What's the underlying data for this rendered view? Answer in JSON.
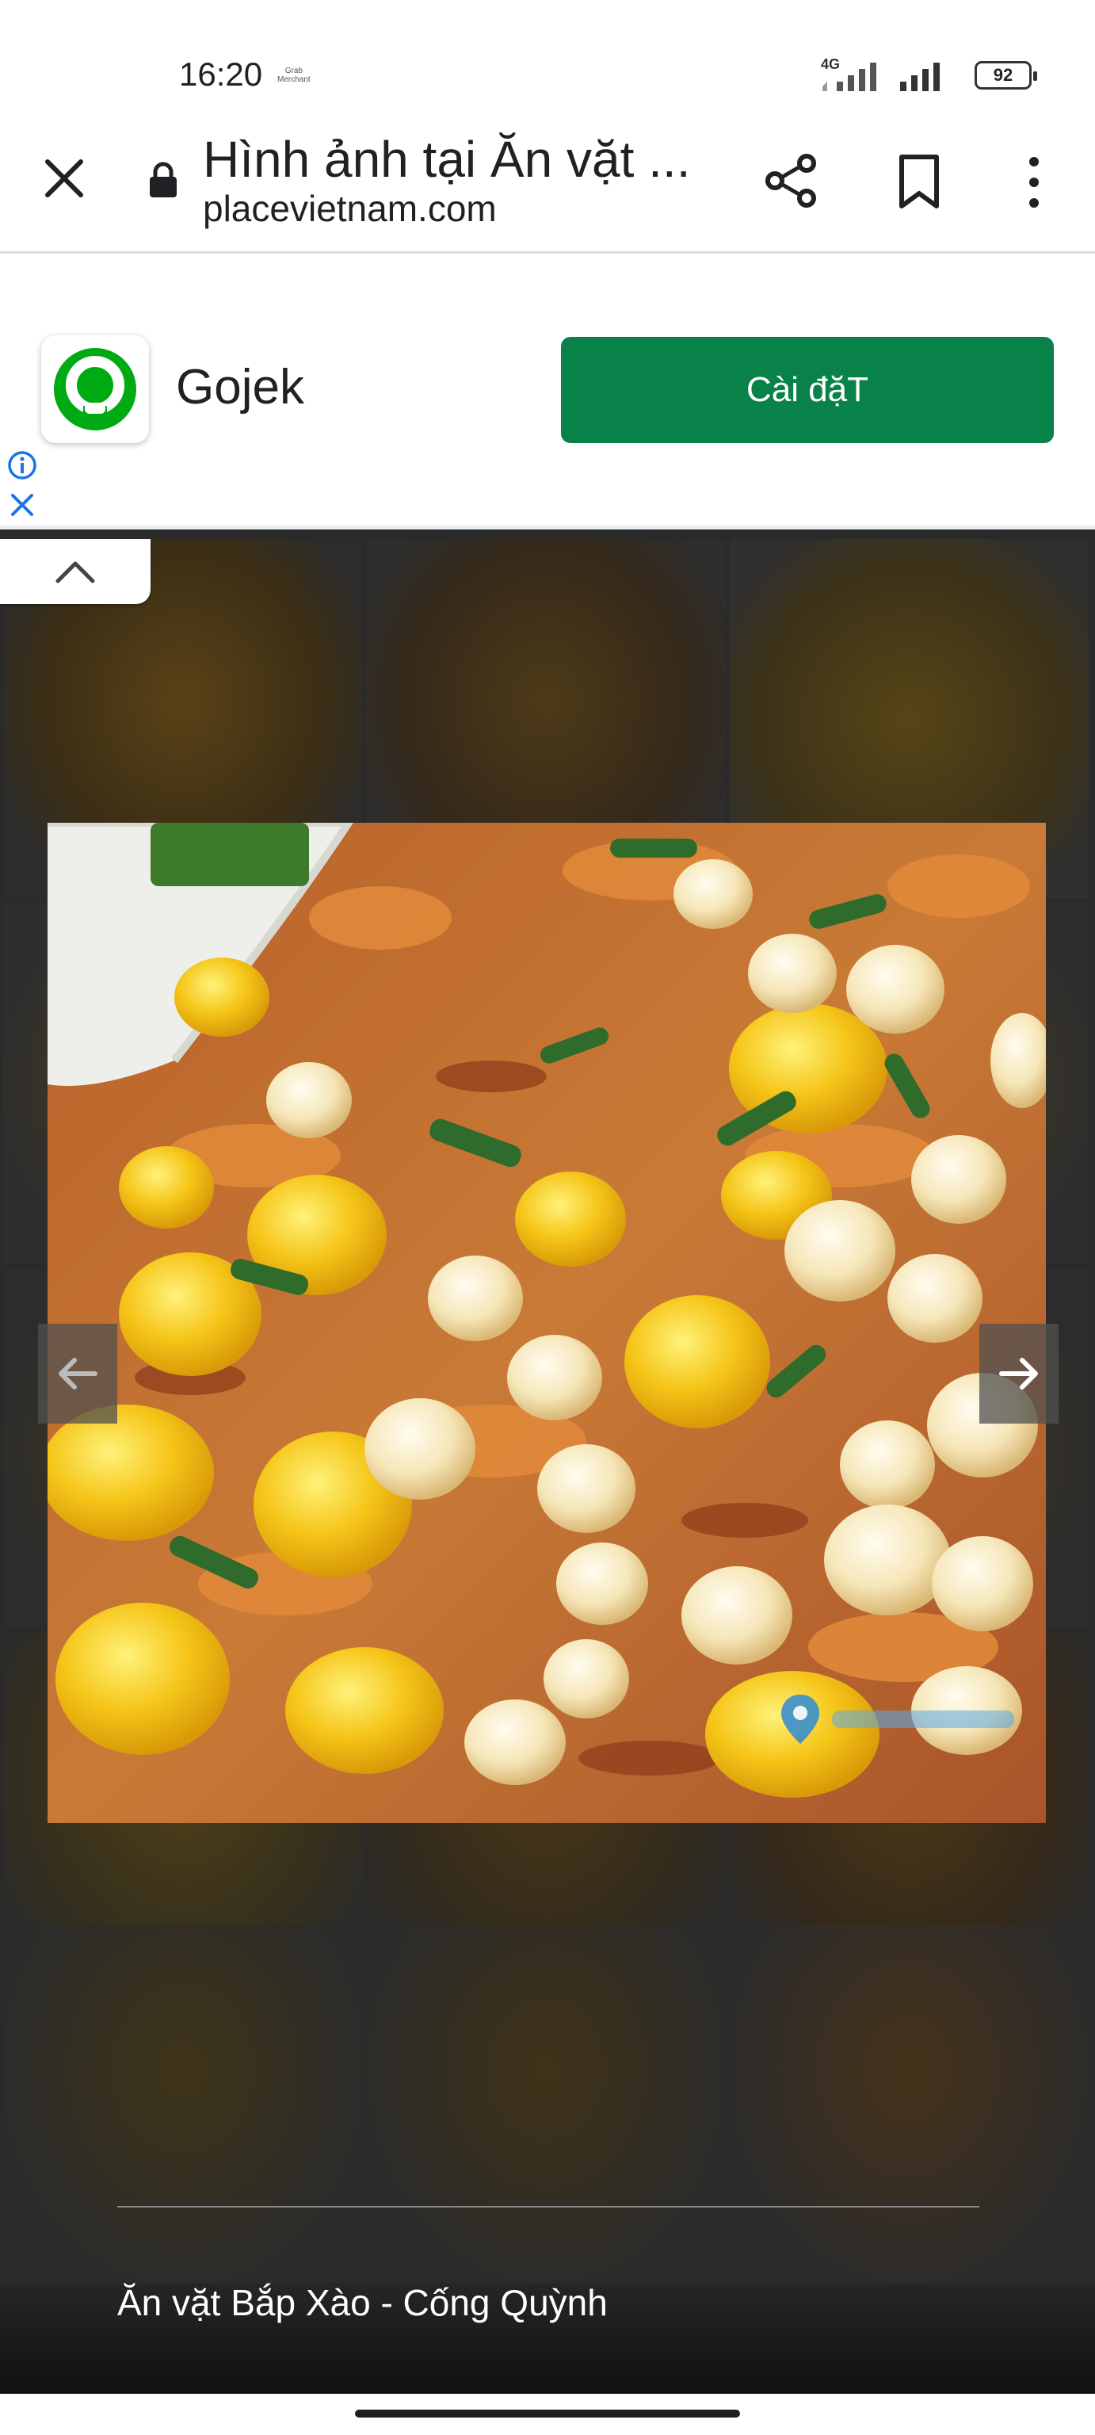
{
  "status_bar": {
    "time": "16:20",
    "merchant_label": "Grab Merchant",
    "network": "4G",
    "battery": "92"
  },
  "toolbar": {
    "title": "Hình ảnh tại Ăn vặt ...",
    "url": "placevietnam.com",
    "icons": [
      "close-icon",
      "lock-icon",
      "share-icon",
      "bookmark-icon",
      "more-vert-icon"
    ]
  },
  "ad": {
    "app_name": "Gojek",
    "install_label": "Cài đặT",
    "brand_color": "#088248",
    "icons": [
      "gojek-logo",
      "info-icon",
      "close-icon"
    ]
  },
  "gallery": {
    "icons": [
      "chevron-up-icon",
      "arrow-left-icon",
      "arrow-right-icon"
    ],
    "photo_subject": "stir-fried corn with dried shrimp and green onion",
    "watermark_icon": "map-pin-icon"
  },
  "caption": "Ăn vặt Bắp Xào - Cống Quỳnh"
}
